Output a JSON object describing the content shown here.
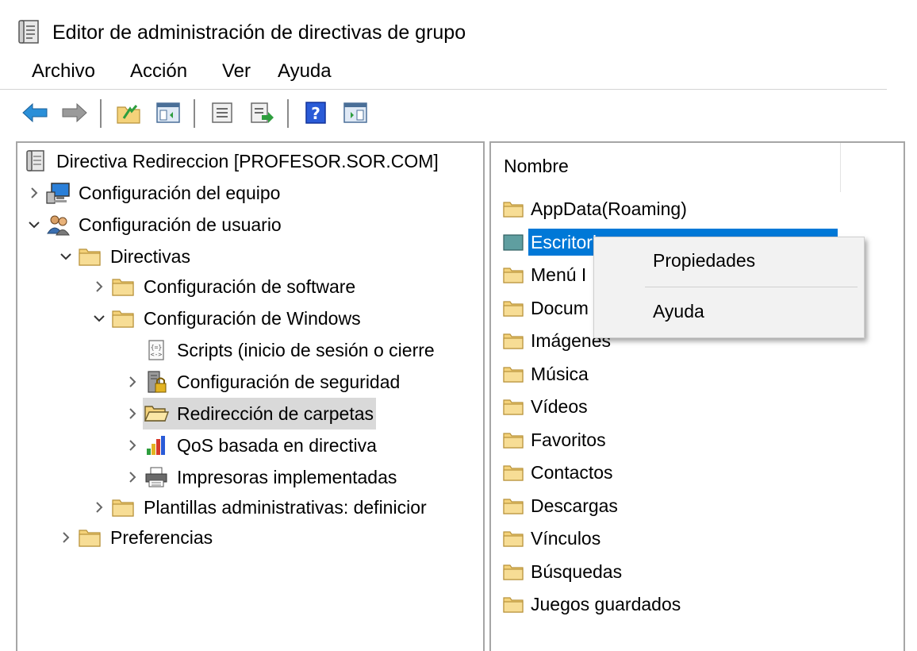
{
  "window": {
    "title": "Editor de administración de directivas de grupo",
    "icon": "gpo-editor-icon"
  },
  "menubar": {
    "items": [
      "Archivo",
      "Acción",
      "Ver",
      "Ayuda"
    ]
  },
  "toolbar": {
    "buttons": [
      "back-arrow-icon",
      "forward-arrow-icon",
      "up-folder-icon",
      "show-hide-tree-icon",
      "properties-icon",
      "export-list-icon",
      "help-icon",
      "action-pane-icon"
    ]
  },
  "tree": {
    "root": "Directiva Redireccion [PROFESOR.SOR.COM]",
    "nodes": [
      {
        "label": "Configuración del equipo"
      },
      {
        "label": "Configuración de usuario"
      },
      {
        "label": "Directivas"
      },
      {
        "label": "Configuración de software"
      },
      {
        "label": "Configuración de Windows"
      },
      {
        "label": "Scripts (inicio de sesión o cierre"
      },
      {
        "label": "Configuración de seguridad"
      },
      {
        "label": "Redirección de carpetas"
      },
      {
        "label": "QoS basada en directiva"
      },
      {
        "label": "Impresoras implementadas"
      },
      {
        "label": "Plantillas administrativas: definicior"
      },
      {
        "label": "Preferencias"
      }
    ],
    "selected": "Redirección de carpetas"
  },
  "list": {
    "column_header": "Nombre",
    "items": [
      {
        "label": "AppData(Roaming)"
      },
      {
        "label": "Escritorio"
      },
      {
        "label": "Menú I"
      },
      {
        "label": "Docum"
      },
      {
        "label": "Imágenes"
      },
      {
        "label": "Música"
      },
      {
        "label": "Vídeos"
      },
      {
        "label": "Favoritos"
      },
      {
        "label": "Contactos"
      },
      {
        "label": "Descargas"
      },
      {
        "label": "Vínculos"
      },
      {
        "label": "Búsquedas"
      },
      {
        "label": "Juegos guardados"
      }
    ],
    "selected": "Escritorio"
  },
  "context_menu": {
    "items": [
      "Propiedades",
      "Ayuda"
    ]
  },
  "colors": {
    "selection_blue": "#0078d7",
    "tree_selection_gray": "#d9d9d9",
    "folder_yellow": "#f4d27a"
  }
}
